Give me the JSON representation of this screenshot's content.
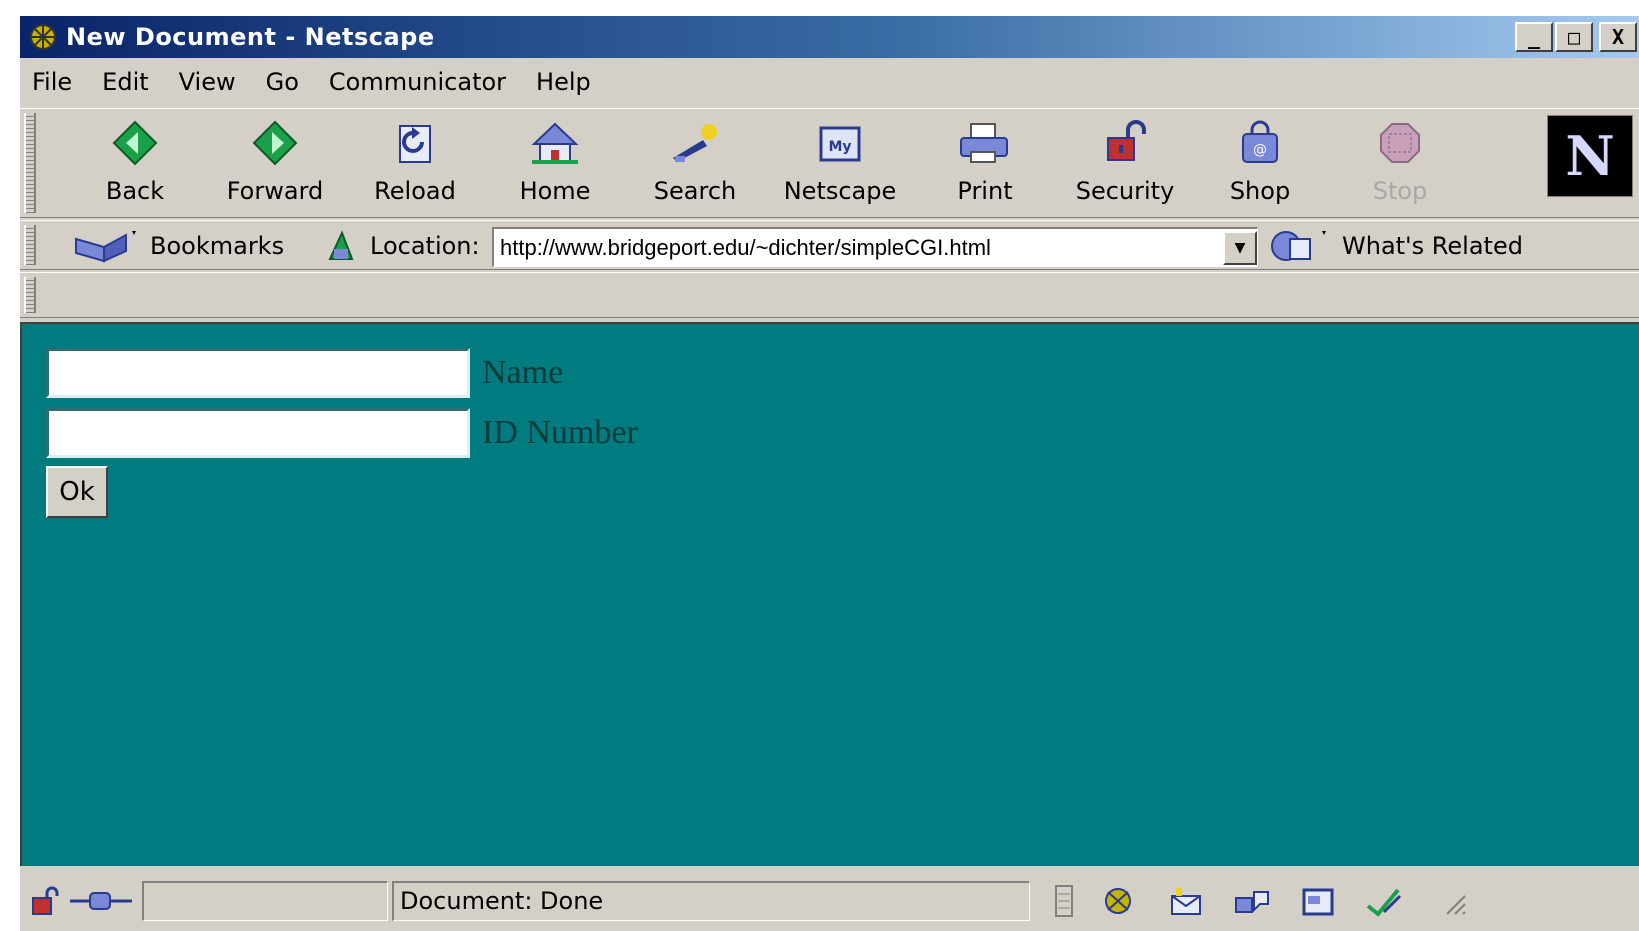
{
  "window": {
    "title": "New Document - Netscape",
    "buttons": {
      "minimize": "_",
      "maximize": "□",
      "close": "X"
    }
  },
  "menu": [
    "File",
    "Edit",
    "View",
    "Go",
    "Communicator",
    "Help"
  ],
  "toolbar": {
    "buttons": [
      {
        "label": "Back",
        "icon": "back-arrow-icon"
      },
      {
        "label": "Forward",
        "icon": "forward-arrow-icon"
      },
      {
        "label": "Reload",
        "icon": "reload-icon"
      },
      {
        "label": "Home",
        "icon": "home-icon"
      },
      {
        "label": "Search",
        "icon": "search-icon"
      },
      {
        "label": "Netscape",
        "icon": "netscape-icon"
      },
      {
        "label": "Print",
        "icon": "printer-icon"
      },
      {
        "label": "Security",
        "icon": "padlock-icon"
      },
      {
        "label": "Shop",
        "icon": "shopping-bag-icon"
      },
      {
        "label": "Stop",
        "icon": "stop-icon",
        "disabled": true
      }
    ],
    "logo": "N"
  },
  "location_bar": {
    "bookmarks_label": "Bookmarks",
    "location_label": "Location:",
    "url": "http://www.bridgeport.edu/~dichter/simpleCGI.html",
    "whats_related_label": "What's Related"
  },
  "page": {
    "background": "#007b7f",
    "fields": [
      {
        "label": "Name",
        "value": ""
      },
      {
        "label": "ID Number",
        "value": ""
      }
    ],
    "ok_button": "Ok"
  },
  "status": {
    "text": "Document: Done"
  },
  "colors": {
    "chrome": "#d4d0c8",
    "titlebar_start": "#0a246a",
    "titlebar_end": "#a6caf0",
    "content_bg": "#007b7f"
  }
}
